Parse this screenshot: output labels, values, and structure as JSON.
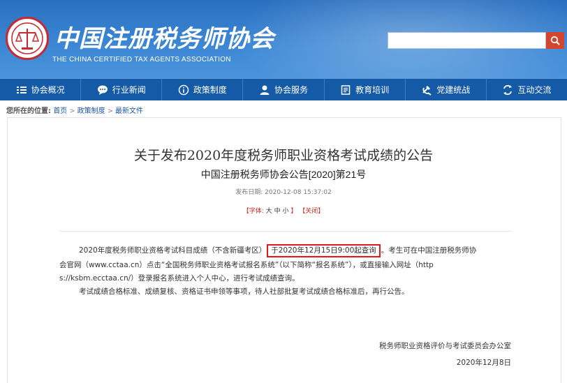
{
  "header": {
    "logo_cn": "中国注册税务师协会",
    "logo_en": "THE CHINA CERTIFIED TAX AGENTS ASSOCIATION",
    "search_placeholder": ""
  },
  "nav": {
    "items": [
      {
        "label": "协会概况",
        "icon": "menu-icon"
      },
      {
        "label": "行业新闻",
        "icon": "chat-bubble-icon"
      },
      {
        "label": "政策制度",
        "icon": "info-icon"
      },
      {
        "label": "协会服务",
        "icon": "user-icon"
      },
      {
        "label": "教育培训",
        "icon": "book-icon"
      },
      {
        "label": "党建统战",
        "icon": "party-emblem-icon"
      },
      {
        "label": "互动交流",
        "icon": "exchange-icon"
      }
    ]
  },
  "breadcrumb": {
    "here": "您所在的位置:",
    "items": [
      "首页",
      "政策制度",
      "最新文件"
    ],
    "separator": ">"
  },
  "article": {
    "title": "关于发布2020年度税务师职业资格考试成绩的公告",
    "subtitle": "中国注册税务师协会公告[2020]第21号",
    "date_label": "发布日期:",
    "date_value": "2020-12-08 15:37:02",
    "font_label": "【字体:",
    "font_large": "大",
    "font_medium": "中",
    "font_small": "小",
    "font_end": "】",
    "close_label": "【关闭】",
    "p1_a": "2020年度税务师职业资格考试科目成绩（不含新疆考区）",
    "p1_highlight": "于2020年12月15日9:00起查询",
    "p1_b": "。考生可在中国注册税务师协",
    "p1_line2": "会官网（www.cctaa.cn）点击“全国税务师职业资格考试报名系统”（以下简称“报名系统”），或直接输入网址（http",
    "p1_line3": "s://ksbm.ecctaa.cn/）登录报名系统进入个人中心，进行考试成绩查询。",
    "p2": "考试成绩合格标准、成绩复核、资格证书申领等事项，待人社部批复考试成绩合格标准后，再行公告。",
    "signer": "税务师职业资格评价与考试委员会办公室",
    "sign_date": "2020年12月8日"
  },
  "colors": {
    "header_blue": "#3b86d4",
    "nav_blue": "#155aa6",
    "highlight_red": "#e0191f",
    "search_red": "#d4452e"
  }
}
